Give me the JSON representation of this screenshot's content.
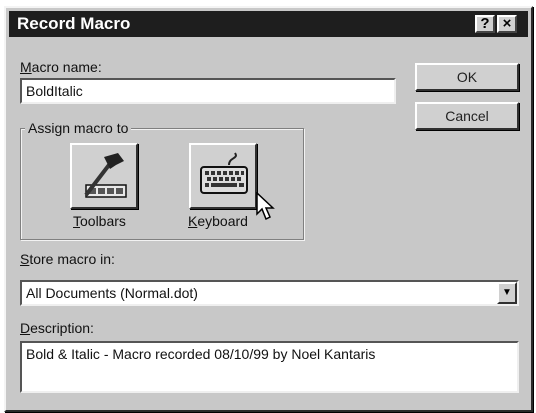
{
  "window": {
    "title": "Record Macro",
    "help_button": "?",
    "close_button": "×"
  },
  "macro_name": {
    "label_accel": "M",
    "label_rest": "acro name:",
    "value": "BoldItalic"
  },
  "buttons": {
    "ok": "OK",
    "cancel": "Cancel"
  },
  "assign": {
    "group_label": "Assign macro to",
    "toolbars_accel": "T",
    "toolbars_rest": "oolbars",
    "keyboard_accel": "K",
    "keyboard_rest": "eyboard",
    "toolbars_icon": "hammer-icon",
    "keyboard_icon": "keyboard-icon"
  },
  "store": {
    "label_accel": "S",
    "label_rest": "tore macro in:",
    "selected": "All Documents (Normal.dot)",
    "dropdown_icon": "chevron-down-icon"
  },
  "description": {
    "label_accel": "D",
    "label_rest": "escription:",
    "value": "Bold & Italic - Macro recorded 08/10/99 by Noel Kantaris"
  },
  "colors": {
    "dialog_bg": "#c8c8c8",
    "titlebar_bg": "#1e1e1e",
    "field_bg": "#ffffff"
  }
}
